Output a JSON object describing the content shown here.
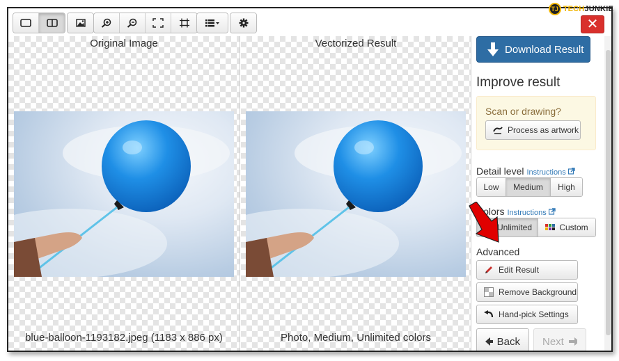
{
  "branding": {
    "logo_letter": "TJ",
    "logo_text_accent": "TECH",
    "logo_text_rest": "JUNKIE"
  },
  "toolbar": {
    "groups": [
      [
        "single-view-icon",
        "split-view-icon"
      ],
      [
        "image-icon"
      ],
      [
        "zoom-in-icon",
        "zoom-out-icon",
        "fit-frame-icon",
        "actual-size-icon"
      ],
      [
        "list-menu-icon"
      ],
      [
        "gear-icon"
      ]
    ],
    "close_label": "✕"
  },
  "left_panel": {
    "title": "Original Image",
    "caption": "blue-balloon-1193182.jpeg (1183 x 886 px)"
  },
  "right_panel": {
    "title": "Vectorized Result",
    "caption": "Photo, Medium, Unlimited colors"
  },
  "sidebar": {
    "download_label": "Download Result",
    "improve_title": "Improve result",
    "scan_question": "Scan or drawing?",
    "process_label": "Process as artwork",
    "detail_label": "Detail level",
    "detail_link": "Instructions",
    "detail_options": [
      "Low",
      "Medium",
      "High"
    ],
    "detail_selected": "Medium",
    "colors_label": "Colors",
    "colors_link": "Instructions",
    "colors_options": [
      "Unlimited",
      "Custom"
    ],
    "colors_selected": "Unlimited",
    "advanced_label": "Advanced",
    "advanced_buttons": [
      "Edit Result",
      "Remove Background",
      "Hand-pick Settings"
    ],
    "back_label": "Back",
    "next_label": "Next"
  },
  "colors": {
    "primary": "#2e6da4",
    "danger": "#d9302c",
    "warning_bg": "#fcf8e3",
    "warning_text": "#8a6d3b",
    "link": "#337ab7",
    "balloon": "#1f8fe6",
    "annotation_arrow": "#e00000"
  }
}
